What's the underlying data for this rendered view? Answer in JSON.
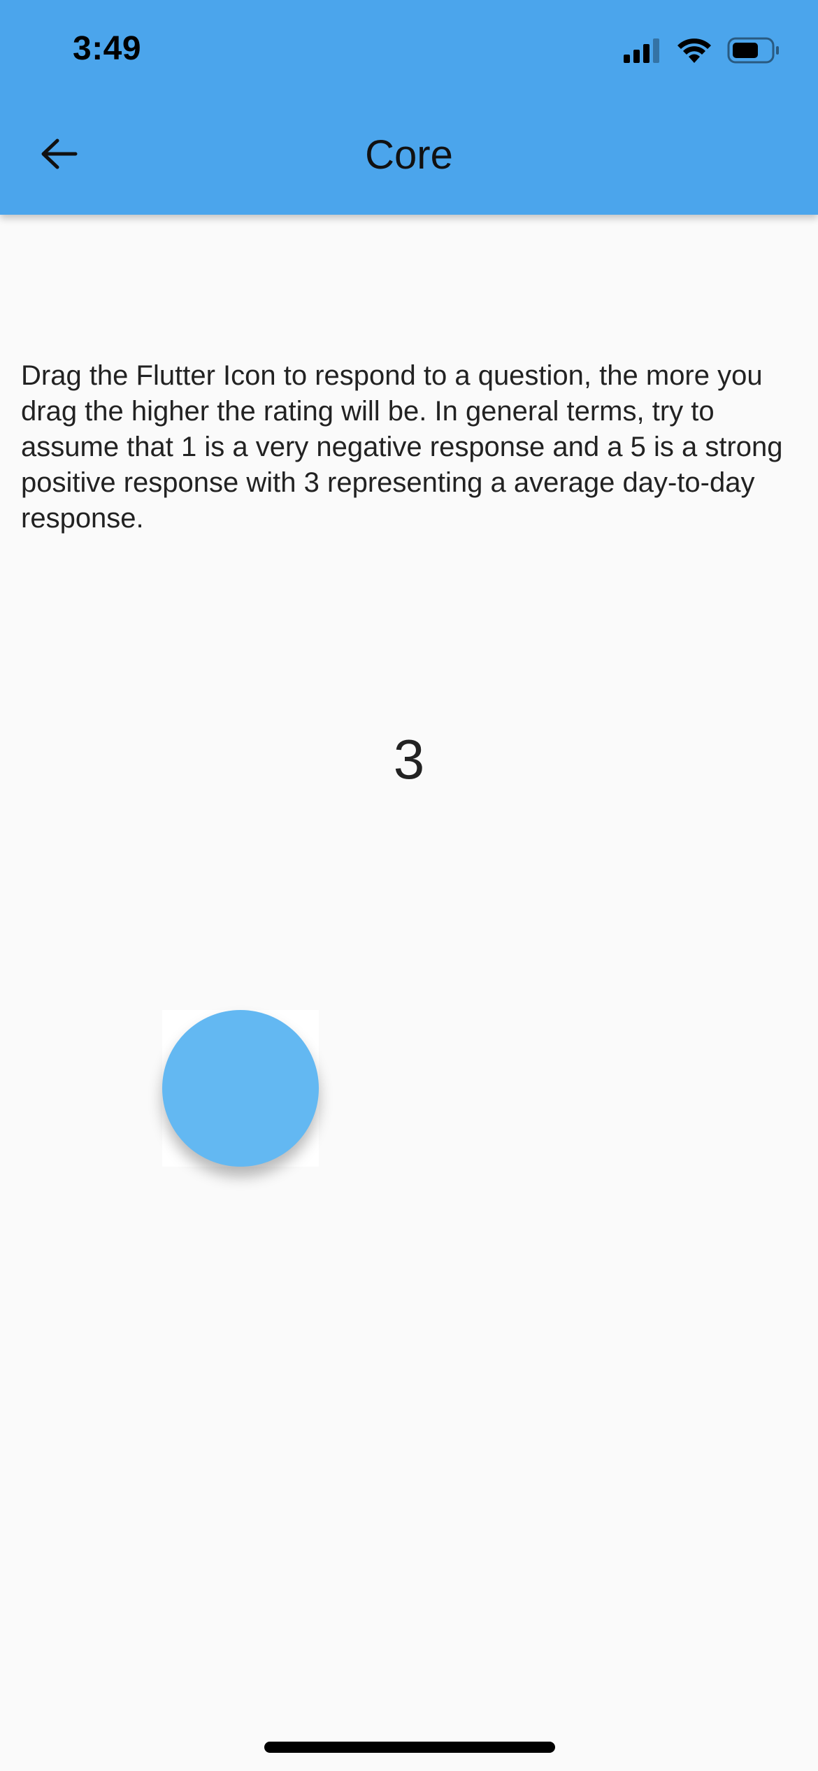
{
  "status_bar": {
    "time": "3:49",
    "icons": [
      "cellular-signal-icon",
      "wifi-icon",
      "battery-icon"
    ]
  },
  "app_bar": {
    "title": "Core",
    "back_icon": "arrow-left-icon",
    "background_color": "#4ba5ec"
  },
  "main": {
    "instructions": "Drag the Flutter Icon to respond to a question, the more you drag the higher the rating will be. In general terms, try to assume that 1 is a very negative response and a 5 is a strong positive response with 3 representing a average day-to-day response.",
    "rating_value": "3",
    "drag_handle_color": "#63b8f2"
  }
}
